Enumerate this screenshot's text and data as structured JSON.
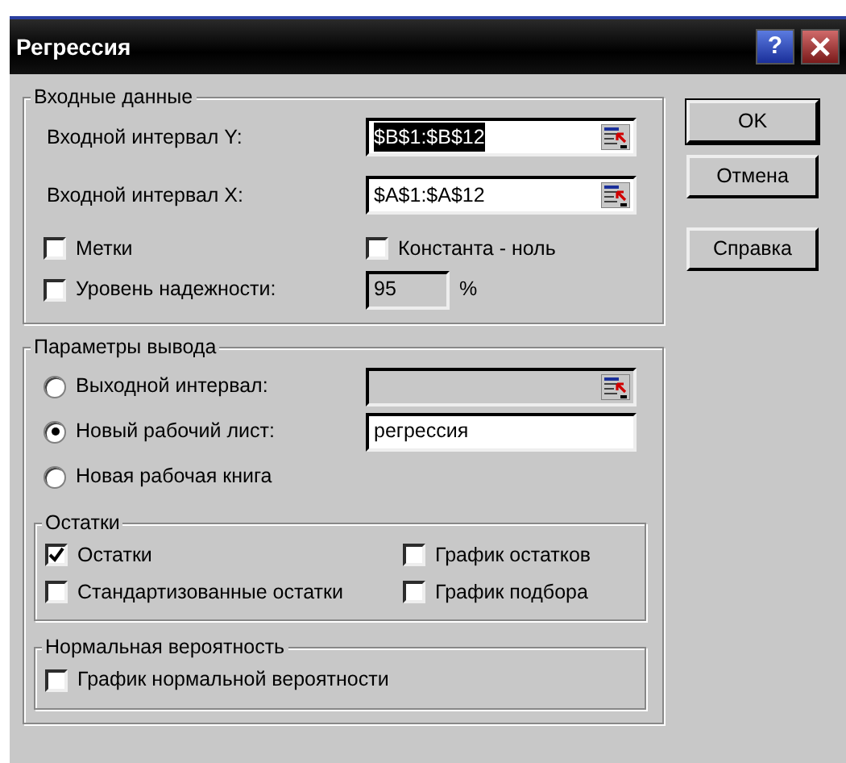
{
  "window": {
    "title": "Регрессия",
    "help": "?"
  },
  "input": {
    "legend": "Входные данные",
    "ranges": [
      {
        "label": "Входной интервал Y:",
        "value": "$B$1:$B$12",
        "selected": true
      },
      {
        "label": "Входной интервал X:",
        "value": "$A$1:$A$12",
        "selected": false
      }
    ],
    "checkboxes": [
      {
        "label": "Метки",
        "checked": false
      },
      {
        "label": "Константа - ноль",
        "checked": false
      }
    ],
    "confidence": {
      "label": "Уровень надежности:",
      "checked": false,
      "value": "95",
      "disabled": true,
      "unit": "%"
    }
  },
  "output": {
    "legend": "Параметры вывода",
    "options": [
      {
        "label": "Выходной интервал:",
        "selected": false,
        "field": {
          "disabled": true,
          "picker": true
        }
      },
      {
        "label": "Новый рабочий лист:",
        "selected": true,
        "field": {
          "value": "регрессия",
          "disabled": false,
          "picker": false
        }
      },
      {
        "label": "Новая рабочая книга",
        "selected": false
      }
    ],
    "residuals": {
      "legend": "Остатки",
      "checkboxes": [
        {
          "label": "Остатки",
          "checked": true
        },
        {
          "label": "График остатков",
          "checked": false
        },
        {
          "label": "Стандартизованные остатки",
          "checked": false
        },
        {
          "label": "График подбора",
          "checked": false
        }
      ]
    },
    "normal": {
      "legend": "Нормальная вероятность",
      "checkboxes": [
        {
          "label": "График нормальной вероятности",
          "checked": false
        }
      ]
    }
  },
  "buttons": [
    [
      "OK",
      "Отмена"
    ],
    [
      "Справка"
    ]
  ]
}
